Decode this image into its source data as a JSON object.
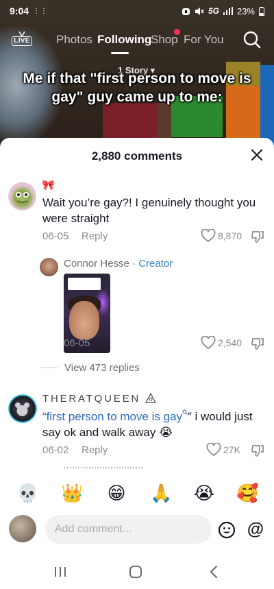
{
  "status_bar": {
    "time": "9:04",
    "network": "5G",
    "battery": "23%"
  },
  "top_nav": {
    "live_label": "LIVE",
    "tabs": [
      {
        "label": "Photos",
        "active": false
      },
      {
        "label": "Following",
        "active": true
      },
      {
        "label": "Shop",
        "active": false,
        "badge": true
      },
      {
        "label": "For You",
        "active": false
      }
    ],
    "icons": {
      "search": "search-icon",
      "live": "live-tv-icon"
    }
  },
  "video": {
    "story_pill": "1 Story ▾",
    "caption": "Me if that \"first person to move is gay\" guy came up to me:"
  },
  "comments_sheet": {
    "count_label": "2,880 comments",
    "close_icon": "close-icon",
    "comments": [
      {
        "username_emoji": "🎀",
        "text": "Wait you’re gay?! I genuinely thought you were straight",
        "date": "06-05",
        "reply_label": "Reply",
        "likes": "8,870"
      }
    ],
    "reply": {
      "username": "Connor Hesse",
      "separator": " · ",
      "creator_label": "Creator",
      "date": "06-05",
      "likes": "2,540"
    },
    "view_replies_label": "View 473 replies",
    "comment2": {
      "username": "THERATQUEEN",
      "quote_open": "“",
      "link_text": "first person to move is gay",
      "quote_close": "” i would just say ok and walk away 😭",
      "date": "06-02",
      "reply_label": "Reply",
      "likes": "27K"
    }
  },
  "emoji_bar": [
    "💀",
    "👑",
    "😁",
    "🙏",
    "😭",
    "🥰"
  ],
  "composer": {
    "placeholder": "Add comment...",
    "mention_label": "@"
  },
  "colors": {
    "accent_red": "#fe2c55",
    "link_blue": "#2f6bbf",
    "creator_blue": "#3b82c8",
    "meta_gray": "#8a8b91"
  }
}
